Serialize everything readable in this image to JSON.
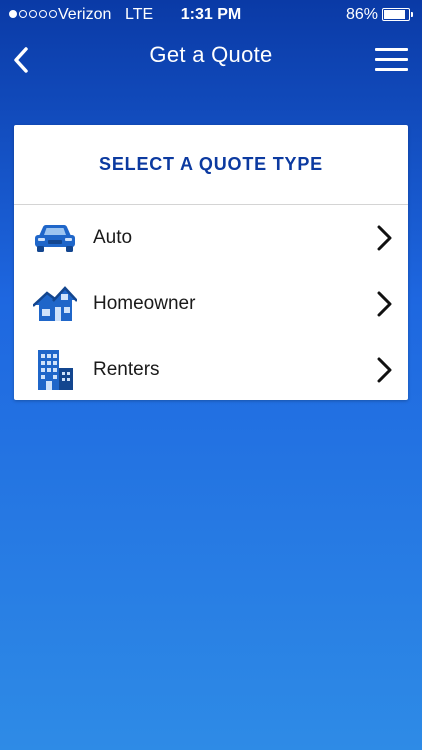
{
  "status_bar": {
    "signal_filled": 1,
    "signal_total": 5,
    "carrier": "Verizon",
    "network": "LTE",
    "time": "1:31 PM",
    "battery_percent_text": "86%",
    "battery_level": 0.86
  },
  "nav": {
    "back_icon": "chevron-left-icon",
    "title": "Get a Quote",
    "menu_icon": "hamburger-menu-icon"
  },
  "card": {
    "title": "SELECT A QUOTE TYPE",
    "options": [
      {
        "label": "Auto",
        "icon": "car-icon"
      },
      {
        "label": "Homeowner",
        "icon": "house-icon"
      },
      {
        "label": "Renters",
        "icon": "apartment-building-icon"
      }
    ]
  },
  "colors": {
    "gradient_top": "#0a3aa6",
    "gradient_bottom": "#2e8be6",
    "title_blue": "#0c3aa0",
    "icon_blue": "#1f66c9"
  }
}
